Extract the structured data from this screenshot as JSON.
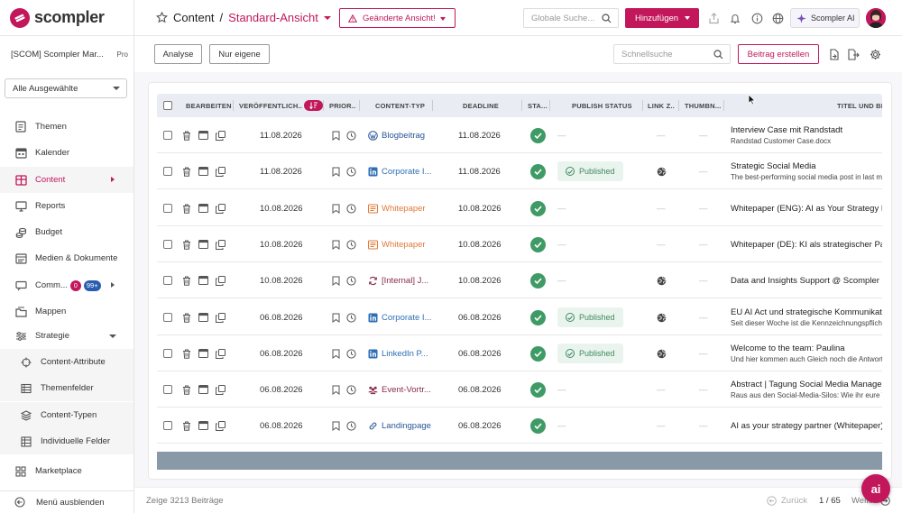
{
  "brand": {
    "name": "scompler",
    "color": "#c2185b"
  },
  "sidebar": {
    "workspace": "[SCOM] Scompler Mar...",
    "plan": "Pro",
    "filter": "Alle Ausgewählte",
    "items": [
      {
        "label": "Themen",
        "icon": "topics-icon"
      },
      {
        "label": "Kalender",
        "icon": "calendar-icon"
      },
      {
        "label": "Content",
        "icon": "content-grid-icon",
        "active": true
      },
      {
        "label": "Reports",
        "icon": "monitor-icon"
      },
      {
        "label": "Budget",
        "icon": "coins-icon"
      },
      {
        "label": "Medien & Dokumente",
        "icon": "media-icon"
      },
      {
        "label": "Comm...",
        "icon": "chat-icon",
        "badge_red": "0",
        "badge_blue": "99+"
      },
      {
        "label": "Mappen",
        "icon": "folder-icon"
      },
      {
        "label": "Strategie",
        "icon": "sliders-icon"
      }
    ],
    "subitems": [
      {
        "label": "Content-Attribute",
        "icon": "target-icon"
      },
      {
        "label": "Themenfelder",
        "icon": "table-icon"
      },
      {
        "label": "Content-Typen",
        "icon": "layers-icon"
      },
      {
        "label": "Individuelle Felder",
        "icon": "fields-icon"
      }
    ],
    "marketplace": "Marketplace",
    "collapse": "Menü ausblenden"
  },
  "header": {
    "section": "Content",
    "separator": "/",
    "view": "Standard-Ansicht",
    "changed_view": "Geänderte Ansicht!",
    "search_placeholder": "Globale Suche...",
    "add_button": "Hinzufügen",
    "ai_button": "Scompler AI"
  },
  "toolbar": {
    "analyse": "Analyse",
    "own_only": "Nur eigene",
    "quick_search_placeholder": "Schnellsuche",
    "create_post": "Beitrag erstellen"
  },
  "table": {
    "columns": {
      "edit": "BEARBEITEN",
      "published": "VERÖFFENTLICH...",
      "priority": "PRIOR...",
      "content_type": "CONTENT-TYP",
      "deadline": "DEADLINE",
      "status": "STA...",
      "publish_status": "PUBLISH STATUS",
      "link": "LINK Z...",
      "thumbnail": "THUMBN...",
      "title": "TITEL UND BESCHREIBUNG"
    },
    "rows": [
      {
        "published": "11.08.2026",
        "type": "Blogbeitrag",
        "type_icon": "wordpress-icon",
        "type_color": "#2b5797",
        "deadline": "11.08.2026",
        "publish_status": "—",
        "link": "—",
        "thumb": "—",
        "title": "Interview Case mit Randstadt",
        "desc": "Randstad Customer Case.docx"
      },
      {
        "published": "11.08.2026",
        "type": "Corporate I...",
        "type_icon": "linkedin-icon",
        "type_color": "#2e6eb5",
        "deadline": "11.08.2026",
        "publish_status": "Published",
        "link": "globe",
        "thumb": "—",
        "title": "Strategic Social Media",
        "desc": "The best-performing social media post in last months"
      },
      {
        "published": "10.08.2026",
        "type": "Whitepaper",
        "type_icon": "whitepaper-icon",
        "type_color": "#e07a3a",
        "deadline": "10.08.2026",
        "publish_status": "—",
        "link": "—",
        "thumb": "—",
        "title": "Whitepaper (ENG): AI as Your Strategy Partner",
        "desc": ""
      },
      {
        "published": "10.08.2026",
        "type": "Whitepaper",
        "type_icon": "whitepaper-icon",
        "type_color": "#e07a3a",
        "deadline": "10.08.2026",
        "publish_status": "—",
        "link": "—",
        "thumb": "—",
        "title": "Whitepaper (DE): KI als strategischer Partner",
        "desc": ""
      },
      {
        "published": "10.08.2026",
        "type": "[Internal] J...",
        "type_icon": "sync-icon",
        "type_color": "#8a2a4a",
        "deadline": "10.08.2026",
        "publish_status": "—",
        "link": "globe",
        "thumb": "—",
        "title": "Data and Insights Support @ Scompler",
        "desc": ""
      },
      {
        "published": "06.08.2026",
        "type": "Corporate I...",
        "type_icon": "linkedin-icon",
        "type_color": "#2e6eb5",
        "deadline": "06.08.2026",
        "publish_status": "Published",
        "link": "globe",
        "thumb": "—",
        "title": "EU AI Act und strategische Kommunikation",
        "desc": "Seit dieser Woche ist die Kennzeichnungspflicht"
      },
      {
        "published": "06.08.2026",
        "type": "LinkedIn P...",
        "type_icon": "linkedin-icon",
        "type_color": "#2e6eb5",
        "deadline": "06.08.2026",
        "publish_status": "Published",
        "link": "globe",
        "thumb": "—",
        "title": "Welcome to the team: Paulina",
        "desc": "Und hier kommen auch Gleich noch die Antworten"
      },
      {
        "published": "06.08.2026",
        "type": "Event-Vortr...",
        "type_icon": "people-icon",
        "type_color": "#8a2a4a",
        "deadline": "06.08.2026",
        "publish_status": "—",
        "link": "—",
        "thumb": "—",
        "title": "Abstract | Tagung Social Media Management",
        "desc": "Raus aus den Social-Media-Silos: Wie ihr eure Themen"
      },
      {
        "published": "06.08.2026",
        "type": "Landingpage",
        "type_icon": "link-icon",
        "type_color": "#2b5797",
        "deadline": "06.08.2026",
        "publish_status": "—",
        "link": "—",
        "thumb": "—",
        "title": "AI as your strategy partner (Whitepaper)",
        "desc": ""
      }
    ]
  },
  "footer": {
    "count": "Zeige  3213 Beiträge",
    "back": "Zurück",
    "page": "1 / 65",
    "next": "Weiter"
  },
  "ai_fab_label": "ai"
}
